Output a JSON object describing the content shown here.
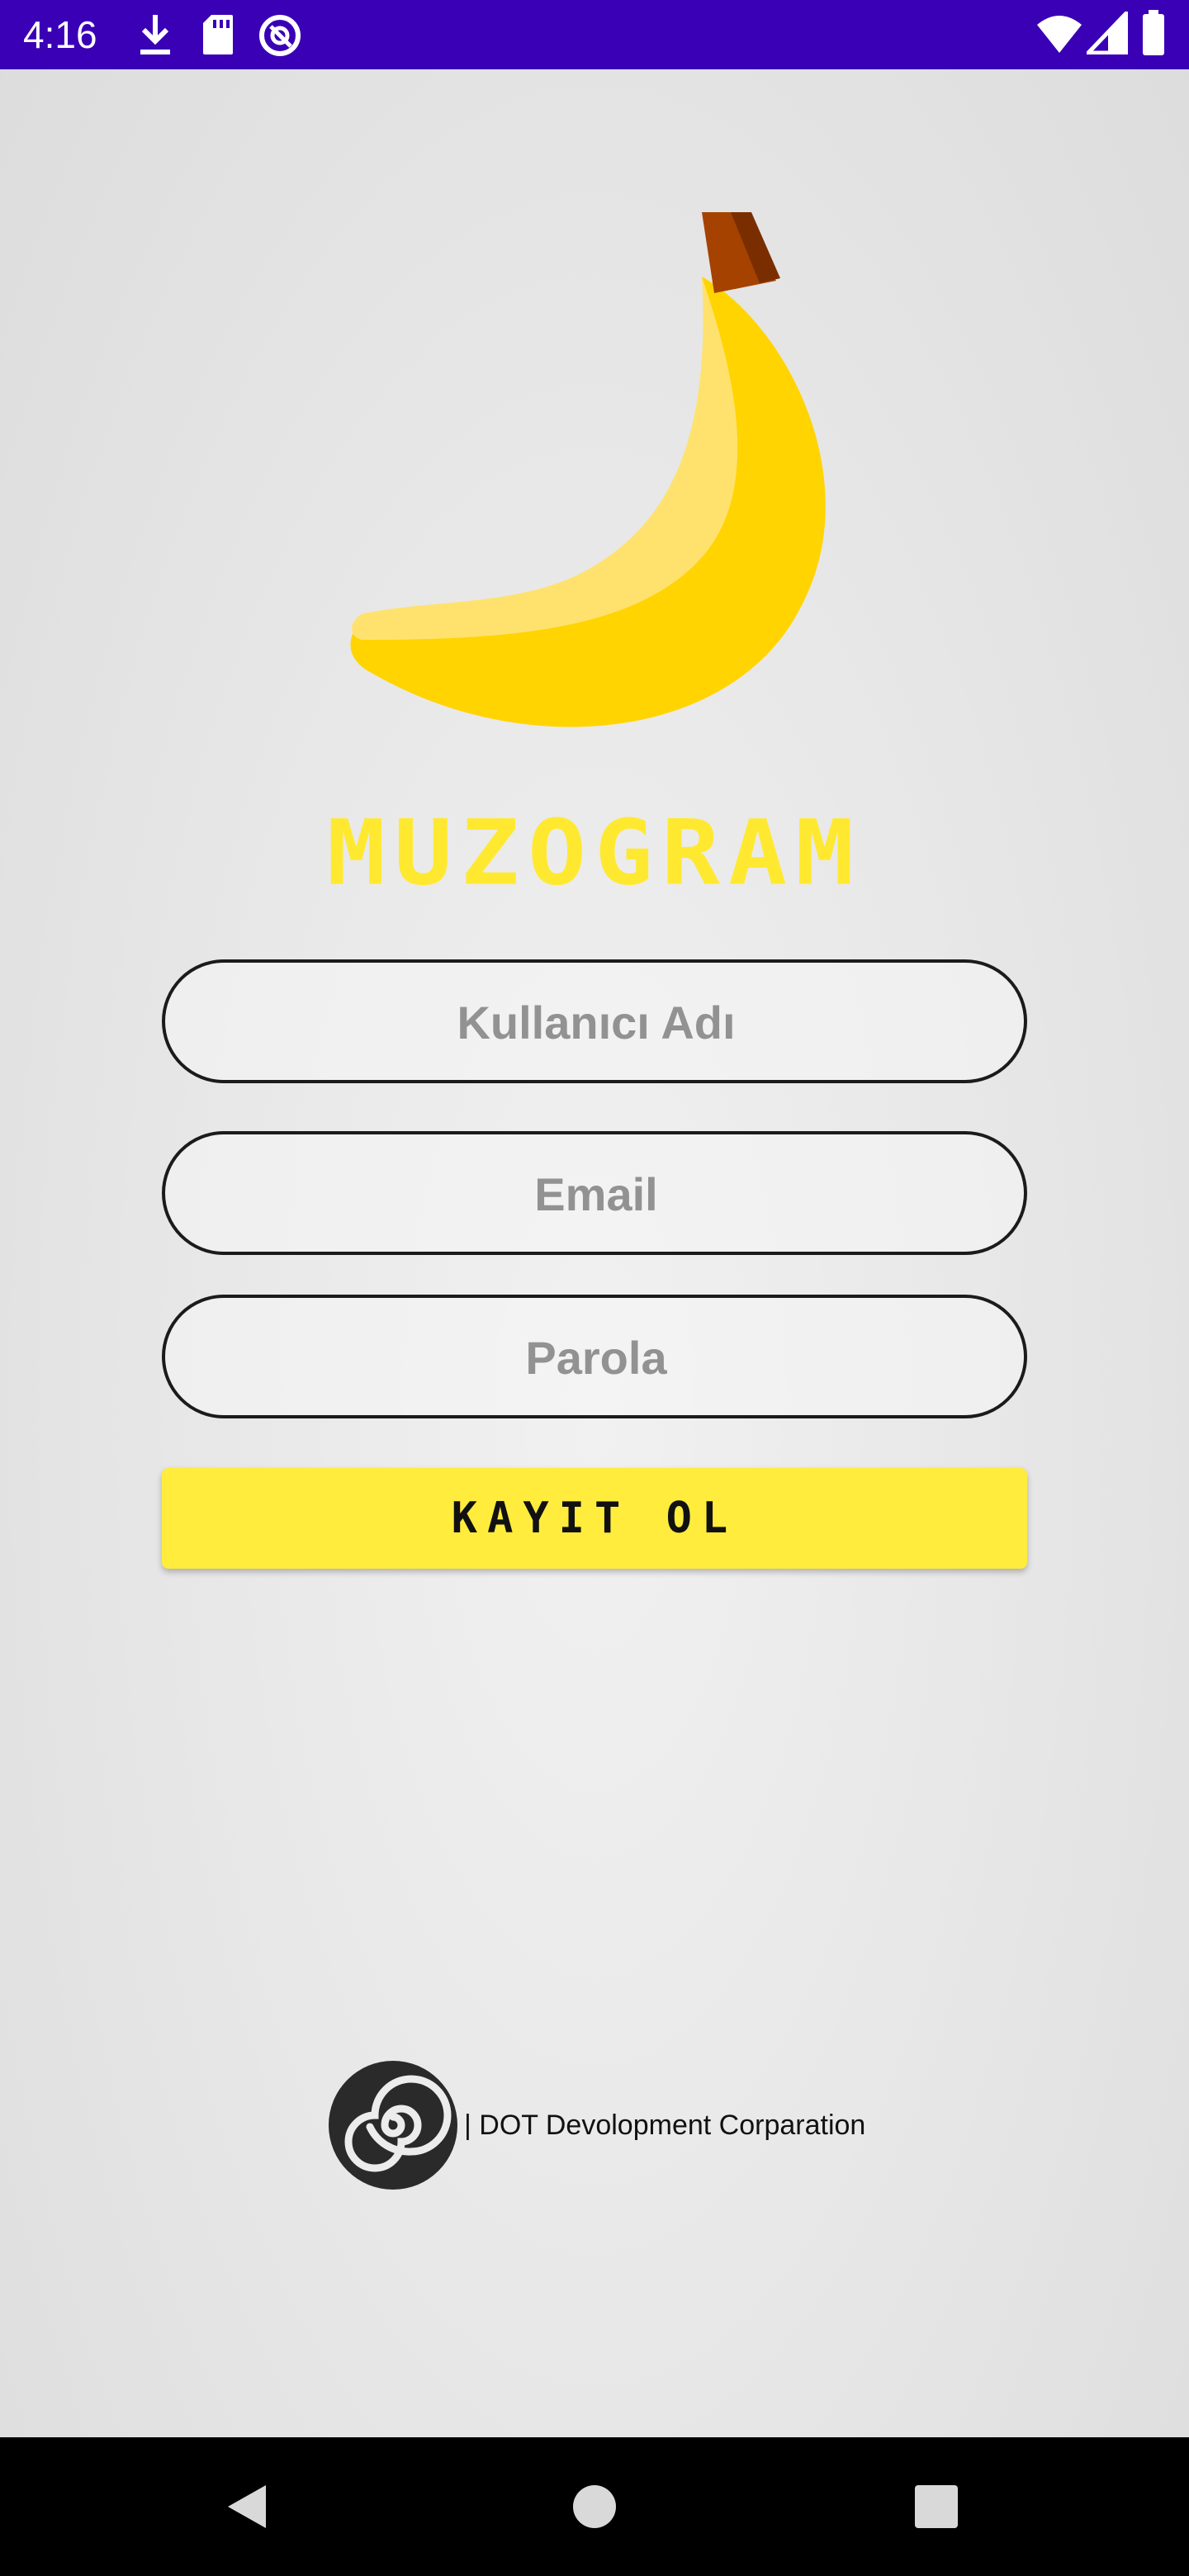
{
  "status_bar": {
    "time": "4:16",
    "left_icons": [
      "download-icon",
      "sd-card-icon",
      "data-saver-icon"
    ],
    "right_icons": [
      "wifi-icon",
      "signal-icon",
      "battery-icon"
    ],
    "background_color": "#3a00b5"
  },
  "app": {
    "title": "MUZOGRAM",
    "title_color": "#ffe930",
    "logo_icon": "banana-icon"
  },
  "form": {
    "username_placeholder": "Kullanıcı Adı",
    "email_placeholder": "Email",
    "password_placeholder": "Parola",
    "username_value": "",
    "email_value": "",
    "password_value": "",
    "register_label": "KAYIT OL",
    "register_color": "#ffec3d"
  },
  "footer": {
    "company_logo_icon": "spiral-logo-icon",
    "company_name": "| DOT Devolopment Corparation"
  },
  "nav_bar": {
    "buttons": [
      "back-icon",
      "home-icon",
      "recents-icon"
    ]
  }
}
